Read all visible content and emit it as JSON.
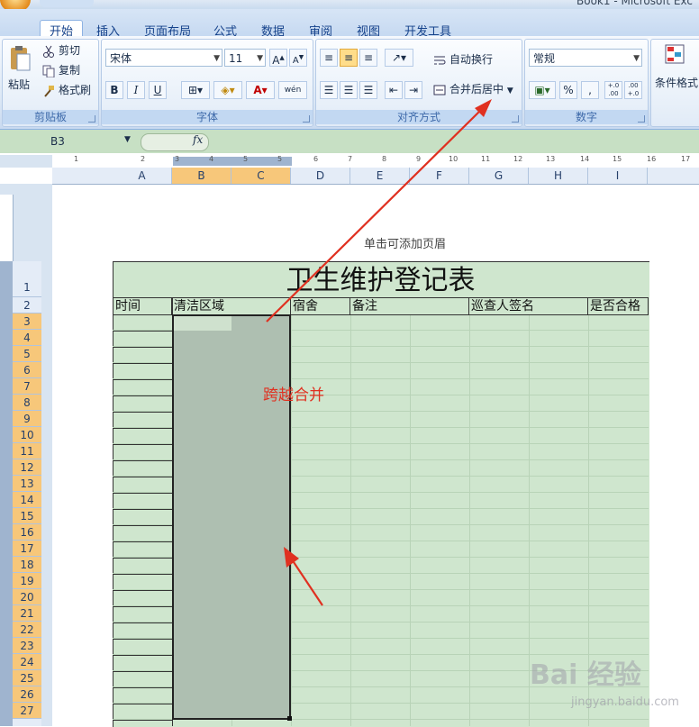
{
  "window": {
    "title": "Book1 - Microsoft Exc"
  },
  "tabs": [
    "开始",
    "插入",
    "页面布局",
    "公式",
    "数据",
    "审阅",
    "视图",
    "开发工具"
  ],
  "active_tab": "开始",
  "ribbon": {
    "clipboard": {
      "label": "剪贴板",
      "paste": "粘贴",
      "cut": "剪切",
      "copy": "复制",
      "format_painter": "格式刷"
    },
    "font": {
      "label": "字体",
      "font_name": "宋体",
      "font_size": "11",
      "bold": "B",
      "italic": "I",
      "underline": "U",
      "font_color_glyph": "A",
      "phonetic_glyph": "wén"
    },
    "alignment": {
      "label": "对齐方式",
      "wrap_text": "自动换行",
      "merge_center": "合并后居中"
    },
    "number": {
      "label": "数字",
      "format": "常规",
      "percent": "%",
      "comma": ",",
      "inc_decimal": "+.0 .00",
      "dec_decimal": ".00 +.0"
    },
    "styles": {
      "conditional_format": "条件格式"
    }
  },
  "formula_bar": {
    "name_box": "B3",
    "fx_label": "fx",
    "content": ""
  },
  "ruler_ticks": [
    "1",
    "2",
    "3",
    "4",
    "5",
    "6",
    "7",
    "8",
    "9",
    "10",
    "11",
    "12",
    "13",
    "14",
    "15",
    "16",
    "17"
  ],
  "columns": [
    "A",
    "B",
    "C",
    "D",
    "E",
    "F",
    "G",
    "H",
    "I"
  ],
  "selected_columns": [
    "B",
    "C"
  ],
  "rows": [
    "1",
    "2",
    "3",
    "4",
    "5",
    "6",
    "7",
    "8",
    "9",
    "10",
    "11",
    "12",
    "13",
    "14",
    "15",
    "16",
    "17",
    "18",
    "19",
    "20",
    "21",
    "22",
    "23",
    "24",
    "25",
    "26",
    "27"
  ],
  "page": {
    "header_hint": "单击可添加页眉"
  },
  "sheet": {
    "title": "卫生维护登记表",
    "headers": [
      "时间",
      "清洁区域",
      "宿舍",
      "备注",
      "巡查人签名",
      "是否合格"
    ]
  },
  "annotation": {
    "text": "跨越合并",
    "color": "#e03020"
  },
  "watermark": {
    "brand": "Bai 经验",
    "url": "jingyan.baidu.com"
  },
  "colors": {
    "sheet_fill": "#cfe6ce",
    "selection_fill": "#aebfb1",
    "header_highlight": "#f7c77a",
    "ribbon_blue": "#15428b"
  }
}
